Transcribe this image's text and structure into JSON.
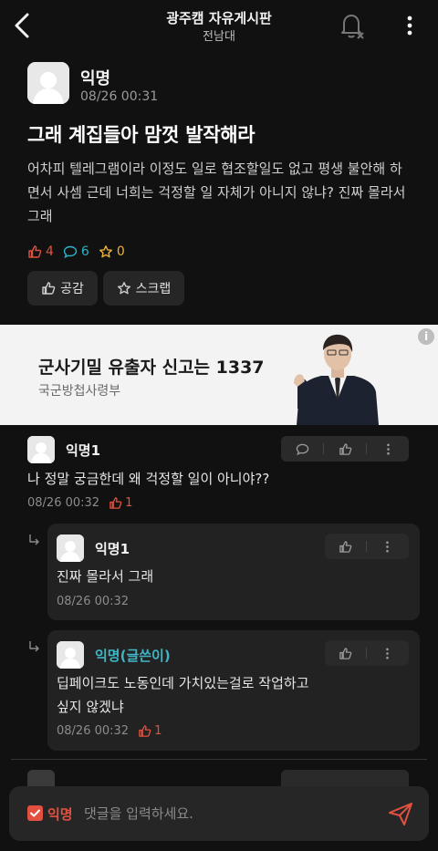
{
  "header": {
    "title": "광주캠 자유게시판",
    "subtitle": "전남대",
    "back_icon": "chevron-left-icon",
    "bell_icon": "bell-off-icon",
    "more_icon": "more-vertical-icon"
  },
  "post": {
    "author": "익명",
    "time": "08/26 00:31",
    "title": "그래 계집들아 맘껏 발작해라",
    "body": "어차피 텔레그램이라 이정도 일로 협조할일도 없고 평생 불안해 하면서 사셈 근데 너희는 걱정할 일 자체가 아니지 않냐? 진짜 몰라서 그래",
    "likes": "4",
    "comments": "6",
    "scraps": "0",
    "like_button": "공감",
    "scrap_button": "스크랩"
  },
  "ad": {
    "title": "군사기밀 유출자 신고는 1337",
    "subtitle": "국군방첩사령부",
    "info_label": "i"
  },
  "comments": [
    {
      "author": "익명1",
      "text": "나 정말 궁금한데 왜 걱정할 일이 아니야??",
      "time": "08/26 00:32",
      "likes": "1"
    }
  ],
  "replies": [
    {
      "author": "익명1",
      "text": "진짜 몰라서 그래",
      "time": "08/26 00:32"
    },
    {
      "author": "익명(글쓴이)",
      "text_line1": "딥페이크도 노동인데 가치있는걸로 작업하고",
      "text_line2": "싶지 않겠냐",
      "time": "08/26 00:32",
      "likes": "1"
    }
  ],
  "input": {
    "anon_label": "익명",
    "placeholder": "댓글을 입력하세요.",
    "send_icon": "send-icon"
  },
  "colors": {
    "background": "#111111",
    "accent_red": "#e25140",
    "accent_teal": "#3fb6c6",
    "scrap_yellow": "#e8b23a"
  }
}
